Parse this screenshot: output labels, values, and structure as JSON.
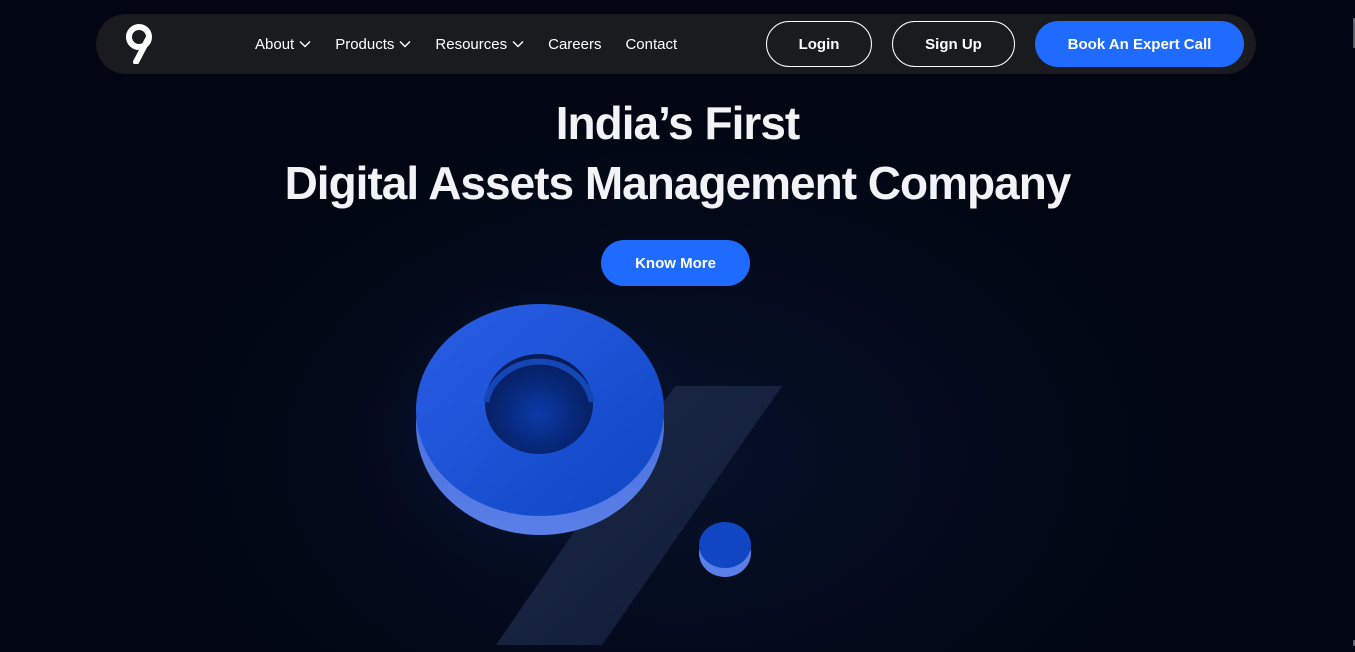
{
  "brand": {
    "logo_glyph": "9"
  },
  "nav": {
    "items": [
      {
        "label": "About",
        "has_dropdown": true
      },
      {
        "label": "Products",
        "has_dropdown": true
      },
      {
        "label": "Resources",
        "has_dropdown": true
      },
      {
        "label": "Careers",
        "has_dropdown": false
      },
      {
        "label": "Contact",
        "has_dropdown": false
      }
    ],
    "login_label": "Login",
    "signup_label": "Sign Up",
    "book_call_label": "Book An Expert Call"
  },
  "hero": {
    "title_line1": "India’s First",
    "title_line2": "Digital Assets Management Company",
    "cta_label": "Know More"
  },
  "colors": {
    "background": "#020612",
    "navbar": "#1a1b1f",
    "accent": "#1f6bff"
  }
}
